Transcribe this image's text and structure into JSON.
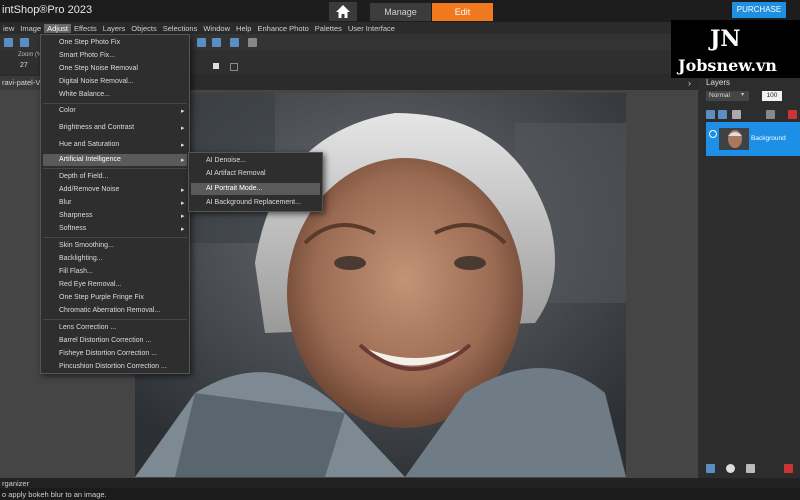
{
  "app": {
    "title": "intShop®Pro 2023"
  },
  "nav": {
    "manage_label": "Manage",
    "edit_label": "Edit",
    "purchase_label": "PURCHASE"
  },
  "menubar": [
    "View",
    "Image",
    "Adjust",
    "Effects",
    "Layers",
    "Objects",
    "Selections",
    "Window",
    "Help",
    "Enhance Photo",
    "Palettes",
    "User Interface"
  ],
  "menubar_display": [
    "iew",
    "Image",
    "Adjust",
    "Effects",
    "Layers",
    "Objects",
    "Selections",
    "Window",
    "Help",
    "Enhance Photo",
    "Palettes",
    "User Interface"
  ],
  "toolbar": {
    "zoom_label": "Zoom (%",
    "zoom_value": "27"
  },
  "document": {
    "tab_label": "ravi-patel-VH"
  },
  "adjust_menu": {
    "groups": [
      [
        "One Step Photo Fix",
        "Smart Photo Fix...",
        "One Step Noise Removal",
        "Digital Noise Removal...",
        "White Balance..."
      ],
      [
        "Color",
        "Brightness and Contrast",
        "Hue and Saturation",
        "Artificial Intelligence"
      ],
      [
        "Depth of Field...",
        "Add/Remove Noise",
        "Blur",
        "Sharpness",
        "Softness"
      ],
      [
        "Skin Smoothing...",
        "Backlighting...",
        "Fill Flash...",
        "Red Eye Removal...",
        "One Step Purple Fringe Fix",
        "Chromatic Aberration Removal..."
      ],
      [
        "Lens Correction ...",
        "Barrel Distortion Correction ...",
        "Fisheye Distortion Correction ...",
        "Pincushion Distortion Correction ..."
      ]
    ],
    "highlighted": "Artificial Intelligence"
  },
  "ai_submenu": {
    "items": [
      "AI Denoise...",
      "AI Artifact Removal",
      "AI Portrait Mode...",
      "AI Background Replacement..."
    ],
    "highlighted": "AI Portrait Mode..."
  },
  "layers_panel": {
    "title": "Layers",
    "blend_mode": "Normal",
    "opacity": "100",
    "layer_name": "Background"
  },
  "bottom": {
    "organizer_label": "Organizer",
    "organizer_display": "rganizer",
    "status_text": "o apply bokeh blur to an image."
  },
  "logo": {
    "mark": "JN",
    "text": "Jobsnew.vn"
  },
  "colors": {
    "accent": "#f0781e",
    "purchase": "#1f8fe0",
    "layer_selected": "#1e8fe6"
  }
}
